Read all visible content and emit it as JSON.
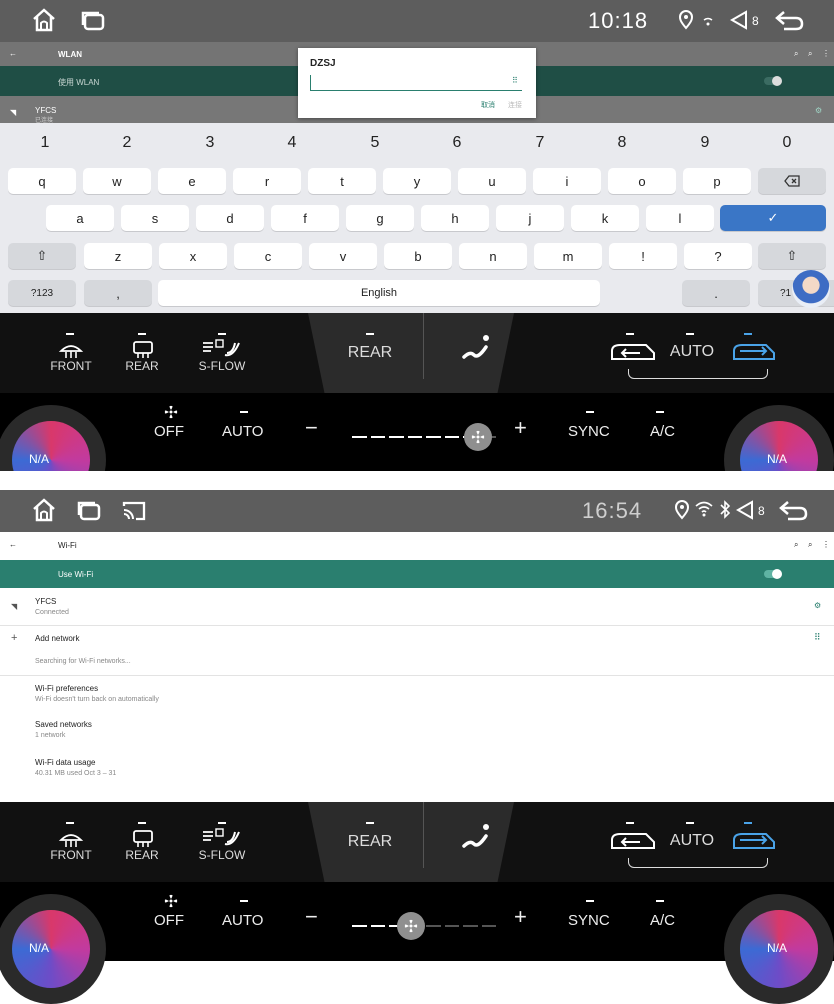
{
  "screen1": {
    "status": {
      "time": "10:18",
      "volume": "8"
    },
    "settings": {
      "title": "WLAN",
      "toggle_label": "使用 WLAN",
      "network_name": "YFCS",
      "network_status": "已连接"
    },
    "dialog": {
      "title": "DZSJ",
      "input_value": "",
      "cancel_label": "取消",
      "connect_label": "连接"
    },
    "keyboard": {
      "numbers": [
        "1",
        "2",
        "3",
        "4",
        "5",
        "6",
        "7",
        "8",
        "9",
        "0"
      ],
      "row1": [
        "q",
        "w",
        "e",
        "r",
        "t",
        "y",
        "u",
        "i",
        "o",
        "p"
      ],
      "row2": [
        "a",
        "s",
        "d",
        "f",
        "g",
        "h",
        "j",
        "k",
        "l"
      ],
      "row3": [
        "z",
        "x",
        "c",
        "v",
        "b",
        "n",
        "m",
        "!",
        "?"
      ],
      "sym_label": "?123",
      "comma": ",",
      "space_label": "English",
      "period": ".",
      "sym_label_right": "?1"
    }
  },
  "screen2": {
    "status": {
      "time": "16:54",
      "volume": "8"
    },
    "settings": {
      "title": "Wi-Fi",
      "toggle_label": "Use Wi-Fi",
      "network_name": "YFCS",
      "network_status": "Connected",
      "add_network": "Add network",
      "searching": "Searching for Wi-Fi networks...",
      "pref_title": "Wi-Fi preferences",
      "pref_sub": "Wi-Fi doesn't turn back on automatically",
      "saved_title": "Saved networks",
      "saved_sub": "1 network",
      "usage_title": "Wi-Fi data usage",
      "usage_sub": "40.31 MB used Oct 3 – 31"
    }
  },
  "climate": {
    "front": "FRONT",
    "rear": "REAR",
    "sflow": "S-FLOW",
    "rear_center": "REAR",
    "auto": "AUTO",
    "off": "OFF",
    "auto_fan": "AUTO",
    "minus": "−",
    "plus": "+",
    "sync": "SYNC",
    "ac": "A/C",
    "na_left": "N/A",
    "na_right": "N/A",
    "fan_level_screen1": 0.85,
    "fan_level_screen2": 0.4
  },
  "colors": {
    "status_bar": "#5d5d5d",
    "wifi_accent": "#2a7f6f",
    "enter_key": "#3a76c6",
    "climate_bg": "#111111",
    "active_blue": "#4aa3e8"
  }
}
